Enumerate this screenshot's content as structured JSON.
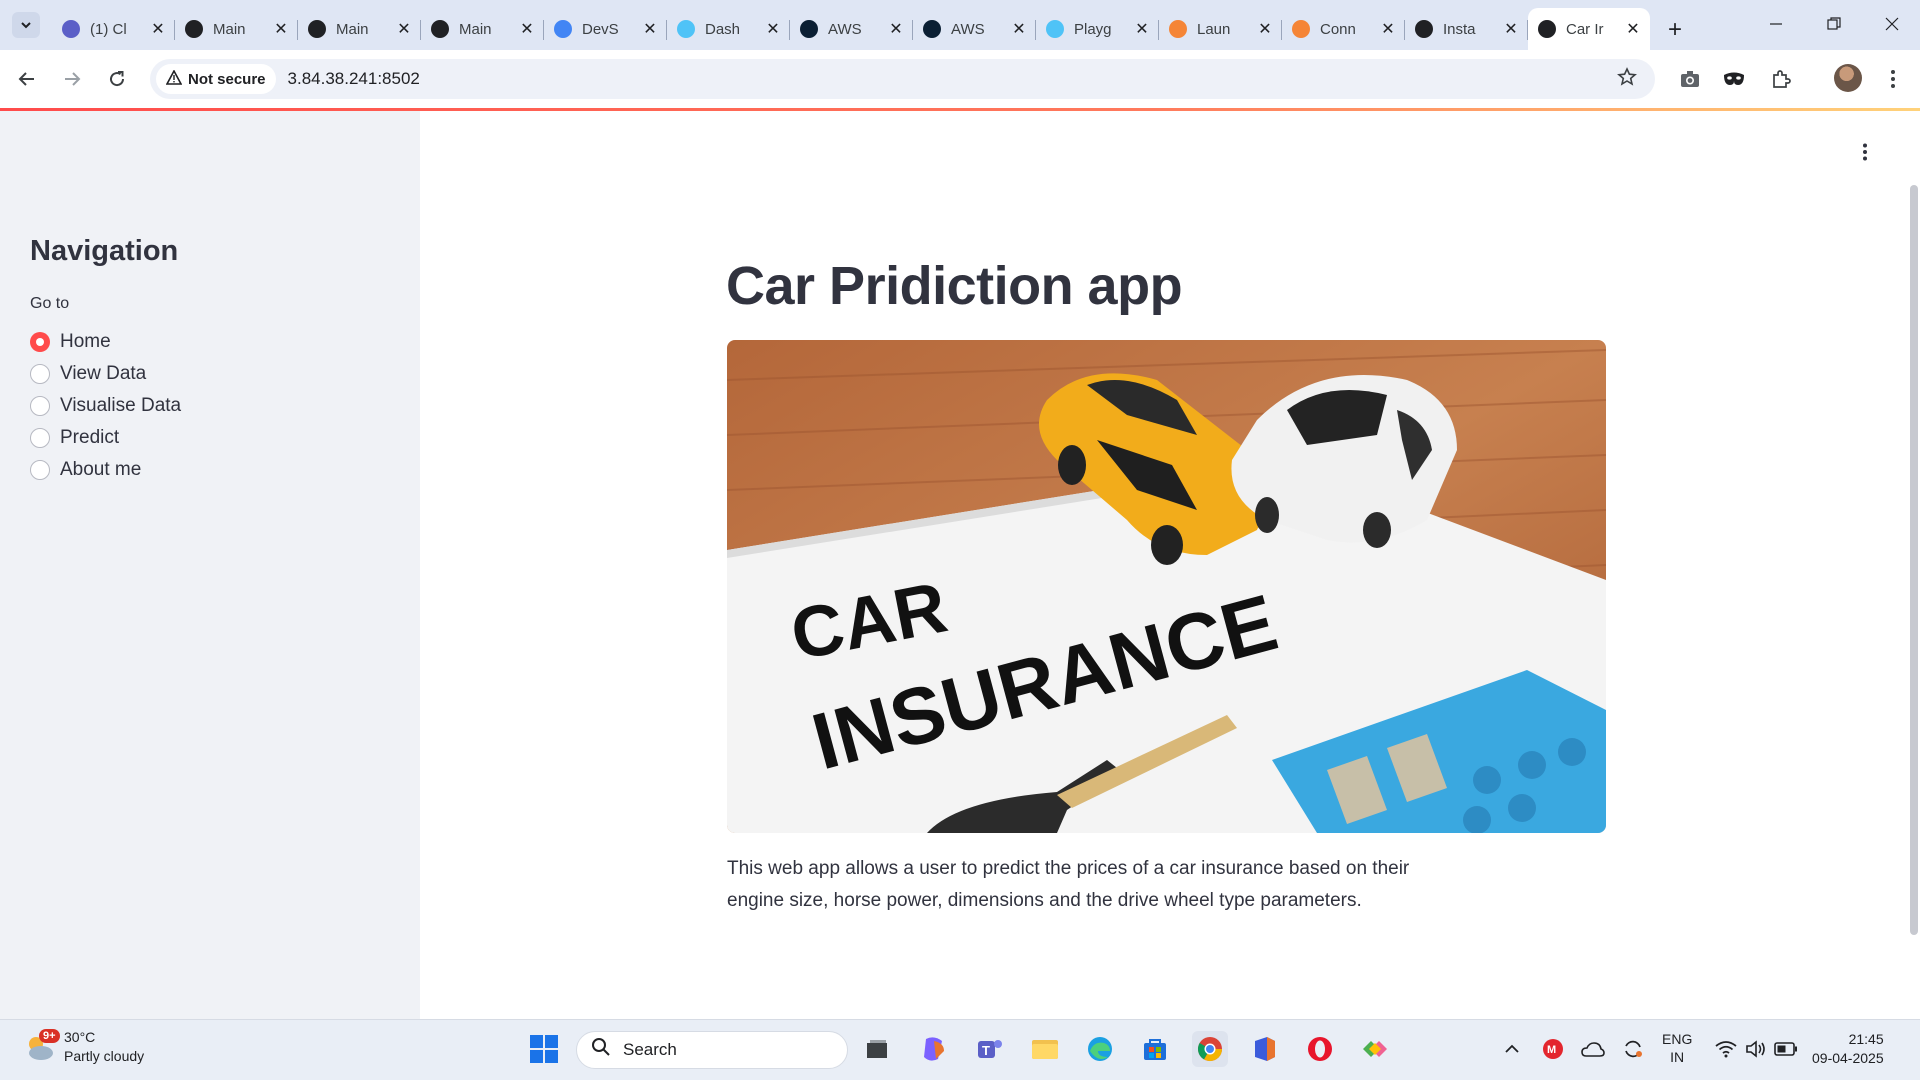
{
  "browser": {
    "tabs": [
      {
        "title": "(1) Cl",
        "icon": "teams-icon",
        "color": "#5b5fc7"
      },
      {
        "title": "Main",
        "icon": "github-icon",
        "color": "#202124"
      },
      {
        "title": "Main",
        "icon": "github-icon",
        "color": "#202124"
      },
      {
        "title": "Main",
        "icon": "github-icon",
        "color": "#202124"
      },
      {
        "title": "DevS",
        "icon": "docs-icon",
        "color": "#4285f4"
      },
      {
        "title": "Dash",
        "icon": "cloud-icon",
        "color": "#4fc3f7"
      },
      {
        "title": "AWS",
        "icon": "aws-eye-icon",
        "color": "#0b1f33"
      },
      {
        "title": "AWS",
        "icon": "aws-eye-icon",
        "color": "#0b1f33"
      },
      {
        "title": "Playg",
        "icon": "cloud-icon",
        "color": "#4fc3f7"
      },
      {
        "title": "Laun",
        "icon": "aws-console-icon",
        "color": "#f58536"
      },
      {
        "title": "Conn",
        "icon": "aws-console-icon",
        "color": "#f58536"
      },
      {
        "title": "Insta",
        "icon": "openai-icon",
        "color": "#202124"
      },
      {
        "title": "Car Ir",
        "icon": "streamlit-crown-icon",
        "color": "#202124",
        "active": true
      }
    ],
    "security_label": "Not secure",
    "url": "3.84.38.241:8502"
  },
  "sidebar": {
    "title": "Navigation",
    "group_label": "Go to",
    "options": [
      {
        "label": "Home",
        "selected": true
      },
      {
        "label": "View Data",
        "selected": false
      },
      {
        "label": "Visualise Data",
        "selected": false
      },
      {
        "label": "Predict",
        "selected": false
      },
      {
        "label": "About me",
        "selected": false
      }
    ]
  },
  "main": {
    "title": "Car Pridiction app",
    "image": {
      "line1": "CAR",
      "line2": "INSURANCE"
    },
    "description": "This web app allows a user to predict the prices of a car insurance based on their engine size, horse power, dimensions and the drive wheel type parameters."
  },
  "taskbar": {
    "weather_badge": "9+",
    "temperature": "30°C",
    "weather": "Partly cloudy",
    "search_label": "Search",
    "language_top": "ENG",
    "language_bottom": "IN",
    "time": "21:45",
    "date": "09-04-2025"
  },
  "colors": {
    "accent": "#ff4b4b",
    "sidebar_bg": "#f0f2f6",
    "text": "#31333f"
  }
}
